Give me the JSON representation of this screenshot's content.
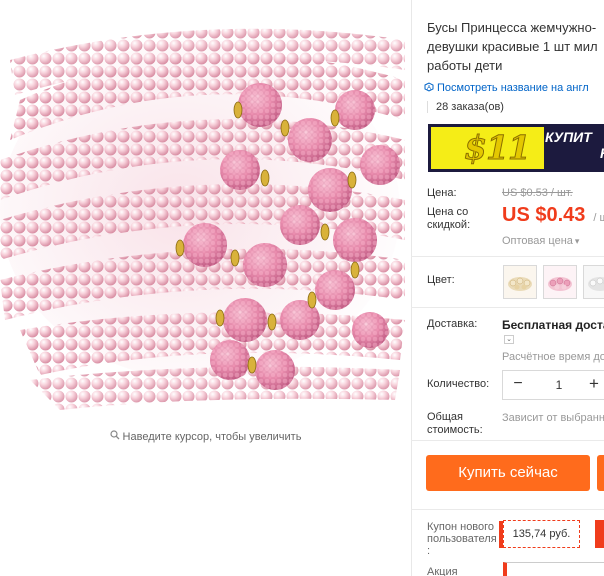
{
  "product": {
    "title_lines": [
      "Бусы Принцесса жемчужно-",
      "девушки красивые 1 шт мил",
      "работы дети"
    ],
    "translate_link": "Посмотреть название на англ",
    "orders": "28 заказа(ов)"
  },
  "image": {
    "zoom_hint": "Наведите курсор, чтобы увеличить"
  },
  "banner": {
    "price": "$11",
    "cta_line1": "КУПИТ",
    "cta_line2": "Н"
  },
  "price": {
    "label": "Цена:",
    "old": "US $0.53 / шт.",
    "discount_label_1": "Цена со",
    "discount_label_2": "скидкой:",
    "new": "US $0.43",
    "new_unit": "/ ш",
    "wholesale": "Оптовая цена",
    "wholesale_arrow": "▾"
  },
  "color": {
    "label": "Цвет:"
  },
  "delivery": {
    "label": "Доставка:",
    "value": "Бесплатная достав",
    "expand_glyph": "⌄",
    "time": "Расчётное время дос"
  },
  "quantity": {
    "label": "Количество:",
    "minus": "−",
    "value": "1",
    "plus": "+"
  },
  "total": {
    "label_1": "Общая",
    "label_2": "стоимость:",
    "value": "Зависит от выбранн"
  },
  "buy_now": {
    "label": "Купить сейчас"
  },
  "coupon": {
    "label_1": "Купон нового",
    "label_2": "пользователя",
    "label_3": ":",
    "value": "135,74 руб."
  },
  "promo": {
    "label": "Акция"
  },
  "colors": {
    "accent_price": "#f03c1c",
    "buy_button": "#ff6b1c",
    "link": "#0064c8",
    "banner_bg": "#1c1a3e",
    "banner_yellow": "#f5ed17"
  }
}
